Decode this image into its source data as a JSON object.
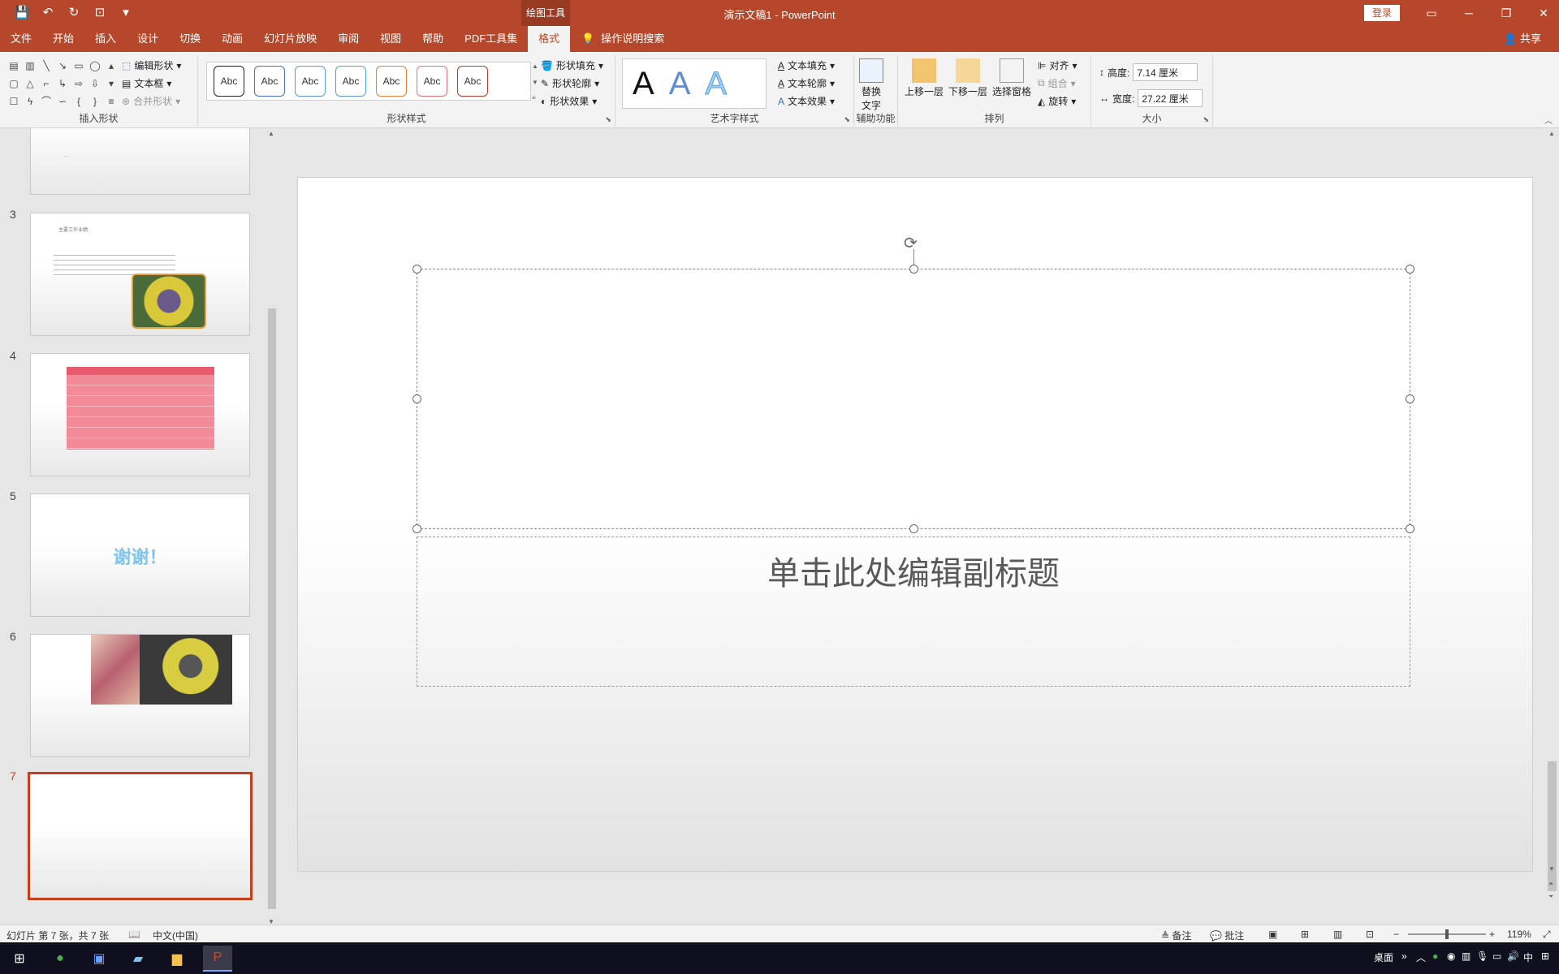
{
  "titlebar": {
    "context_group": "绘图工具",
    "doc_title": "演示文稿1 - PowerPoint",
    "login": "登录"
  },
  "tabs": [
    {
      "label": "文件"
    },
    {
      "label": "开始"
    },
    {
      "label": "插入"
    },
    {
      "label": "设计"
    },
    {
      "label": "切换"
    },
    {
      "label": "动画"
    },
    {
      "label": "幻灯片放映"
    },
    {
      "label": "审阅"
    },
    {
      "label": "视图"
    },
    {
      "label": "帮助"
    },
    {
      "label": "PDF工具集"
    },
    {
      "label": "格式"
    }
  ],
  "tellme": "操作说明搜索",
  "share": "共享",
  "ribbon": {
    "insert_shapes": {
      "label": "插入形状",
      "edit_shape": "编辑形状",
      "textbox": "文本框",
      "merge_shapes": "合并形状"
    },
    "shape_styles": {
      "label": "形状样式",
      "sample": "Abc",
      "colors": [
        "#222222",
        "#4472c4",
        "#5b9bd5",
        "#5b9bd5",
        "#ed7d31",
        "#e57373",
        "#c0392b"
      ],
      "fill": "形状填充",
      "outline": "形状轮廓",
      "effects": "形状效果"
    },
    "wordart": {
      "label": "艺术字样式",
      "letter": "A",
      "fill": "文本填充",
      "outline": "文本轮廓",
      "effects": "文本效果"
    },
    "accessibility": {
      "label": "辅助功能",
      "alt_text_line1": "替换",
      "alt_text_line2": "文字"
    },
    "arrange": {
      "label": "排列",
      "bring_forward": "上移一层",
      "send_backward": "下移一层",
      "selection_pane": "选择窗格",
      "align": "对齐",
      "group": "组合",
      "rotate": "旋转"
    },
    "size": {
      "label": "大小",
      "height_label": "高度:",
      "height_value": "7.14 厘米",
      "width_label": "宽度:",
      "width_value": "27.22 厘米"
    }
  },
  "thumbnails": {
    "slide2_text": "...",
    "slide3_title": "主要工作业绩",
    "slide5_text": "谢谢！",
    "numbers": [
      "3",
      "4",
      "5",
      "6",
      "7"
    ]
  },
  "slide": {
    "subtitle_placeholder": "单击此处编辑副标题"
  },
  "statusbar": {
    "slide_info": "幻灯片 第 7 张，共 7 张",
    "language": "中文(中国)",
    "notes": "备注",
    "comments": "批注",
    "zoom": "119%"
  },
  "taskbar": {
    "desktop": "桌面",
    "ime": "中"
  }
}
